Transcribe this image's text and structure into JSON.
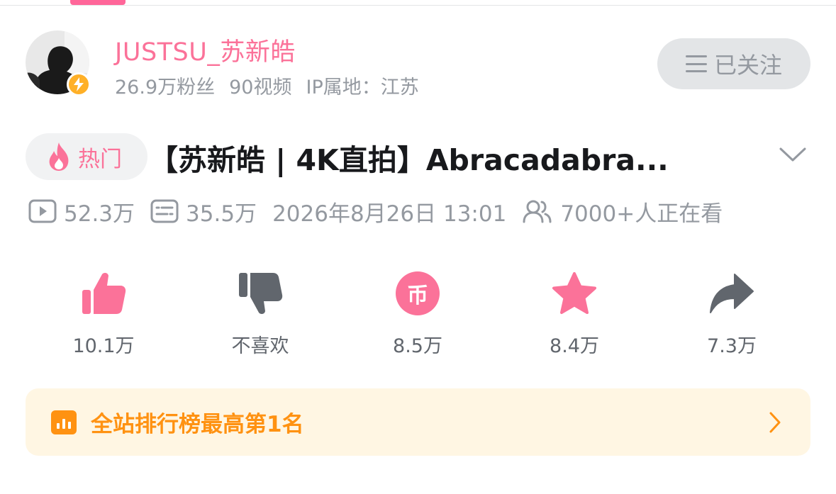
{
  "author": {
    "name": "JUSTSU_苏新皓",
    "fans": "26.9万粉丝",
    "videos": "90视频",
    "ip": "IP属地：江苏",
    "follow_label": "已关注"
  },
  "video": {
    "hot_tag": "热门",
    "title": "【苏新皓 | 4K直拍】Abracadabra...",
    "plays": "52.3万",
    "danmaku": "35.5万",
    "date": "2026年8月26日 13:01",
    "watching": "7000+人正在看"
  },
  "actions": {
    "like": "10.1万",
    "dislike": "不喜欢",
    "coin": "8.5万",
    "coin_glyph": "币",
    "favorite": "8.4万",
    "share": "7.3万"
  },
  "ranking": {
    "text": "全站排行榜最高第1名"
  },
  "colors": {
    "accent_pink": "#fb7299",
    "rank_orange": "#ff9212",
    "rank_bg": "#fff6e3",
    "muted": "#9499a0",
    "icon_dark": "#61666d"
  },
  "icons": [
    "lightning-icon",
    "menu-icon",
    "flame-icon",
    "chevron-down-icon",
    "play-icon",
    "danmaku-icon",
    "viewers-icon",
    "like-icon",
    "dislike-icon",
    "coin-icon",
    "star-icon",
    "share-icon",
    "chart-icon",
    "chevron-right-icon"
  ]
}
